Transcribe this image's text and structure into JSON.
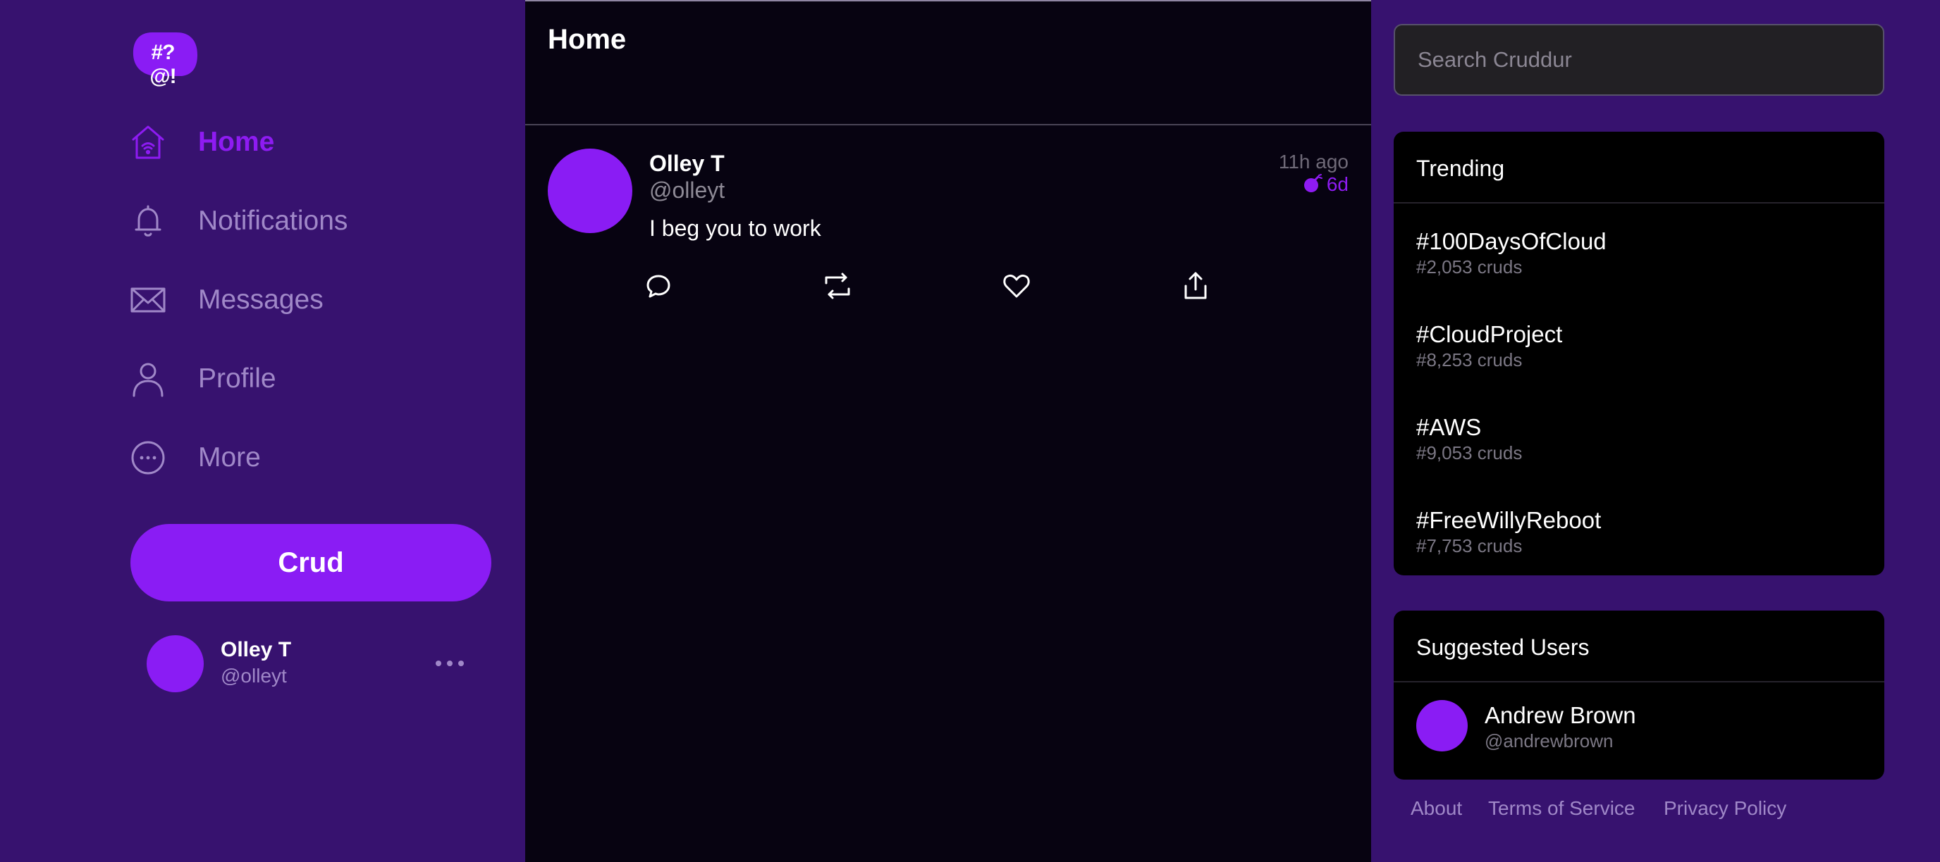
{
  "app": {
    "logo_text": "#?@!",
    "brand_color": "#8a1cf4",
    "sidebar_bg": "#37126f",
    "feed_bg": "#070311"
  },
  "sidebar": {
    "items": [
      {
        "label": "Home",
        "icon": "home-icon",
        "active": true
      },
      {
        "label": "Notifications",
        "icon": "bell-icon",
        "active": false
      },
      {
        "label": "Messages",
        "icon": "envelope-icon",
        "active": false
      },
      {
        "label": "Profile",
        "icon": "user-icon",
        "active": false
      },
      {
        "label": "More",
        "icon": "more-circle-icon",
        "active": false
      }
    ],
    "crud_button": "Crud",
    "profile": {
      "name": "Olley T",
      "handle": "@olleyt"
    }
  },
  "main": {
    "title": "Home",
    "posts": [
      {
        "author": "Olley T",
        "handle": "@olleyt",
        "time": "11h ago",
        "expires": "6d",
        "body": "I beg you to work",
        "actions": [
          "reply-icon",
          "repost-icon",
          "like-icon",
          "share-icon"
        ]
      }
    ]
  },
  "right": {
    "search_placeholder": "Search Cruddur",
    "trending": {
      "title": "Trending",
      "items": [
        {
          "tag": "#100DaysOfCloud",
          "count": "#2,053 cruds"
        },
        {
          "tag": "#CloudProject",
          "count": "#8,253 cruds"
        },
        {
          "tag": "#AWS",
          "count": "#9,053 cruds"
        },
        {
          "tag": "#FreeWillyReboot",
          "count": "#7,753 cruds"
        }
      ]
    },
    "suggested": {
      "title": "Suggested Users",
      "users": [
        {
          "name": "Andrew Brown",
          "handle": "@andrewbrown"
        }
      ]
    },
    "footer": [
      "About",
      "Terms of Service",
      "Privacy Policy"
    ]
  }
}
